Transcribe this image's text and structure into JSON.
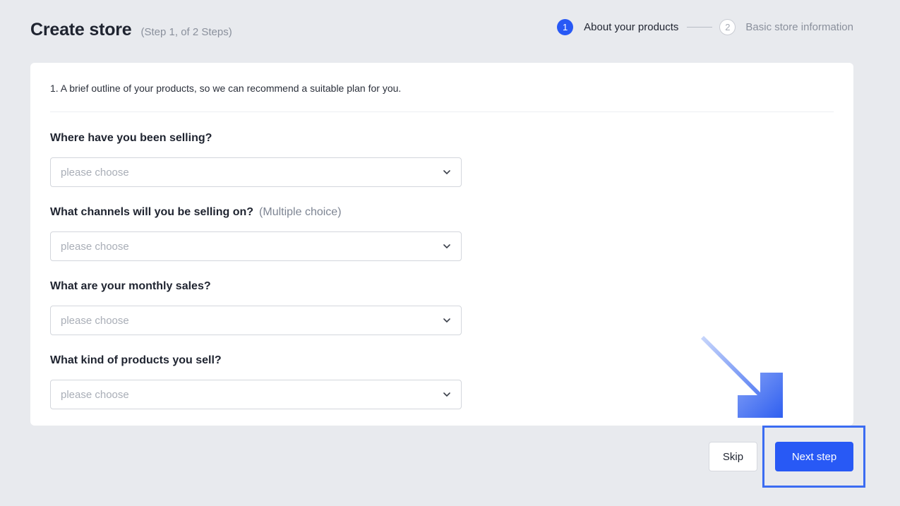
{
  "header": {
    "title": "Create store",
    "subtitle": "(Step 1, of 2 Steps)"
  },
  "stepper": {
    "steps": [
      {
        "number": "1",
        "label": "About your products",
        "state": "active"
      },
      {
        "number": "2",
        "label": "Basic store information",
        "state": "inactive"
      }
    ]
  },
  "form": {
    "intro": "1. A brief outline of your products, so we can recommend a suitable plan for you.",
    "questions": [
      {
        "label": "Where have you been selling?",
        "hint": "",
        "placeholder": "please choose"
      },
      {
        "label": "What channels will you be selling on?",
        "hint": "(Multiple choice)",
        "placeholder": "please choose"
      },
      {
        "label": "What are your monthly sales?",
        "hint": "",
        "placeholder": "please choose"
      },
      {
        "label": "What kind of products you sell?",
        "hint": "",
        "placeholder": "please choose"
      }
    ]
  },
  "actions": {
    "skip_label": "Skip",
    "next_label": "Next step"
  },
  "colors": {
    "accent": "#2859f5",
    "background": "#e8eaee",
    "highlight": "#3b6cf2"
  },
  "icons": {
    "select_chevron": "chevron-down-icon",
    "annotation": "arrow-icon"
  }
}
